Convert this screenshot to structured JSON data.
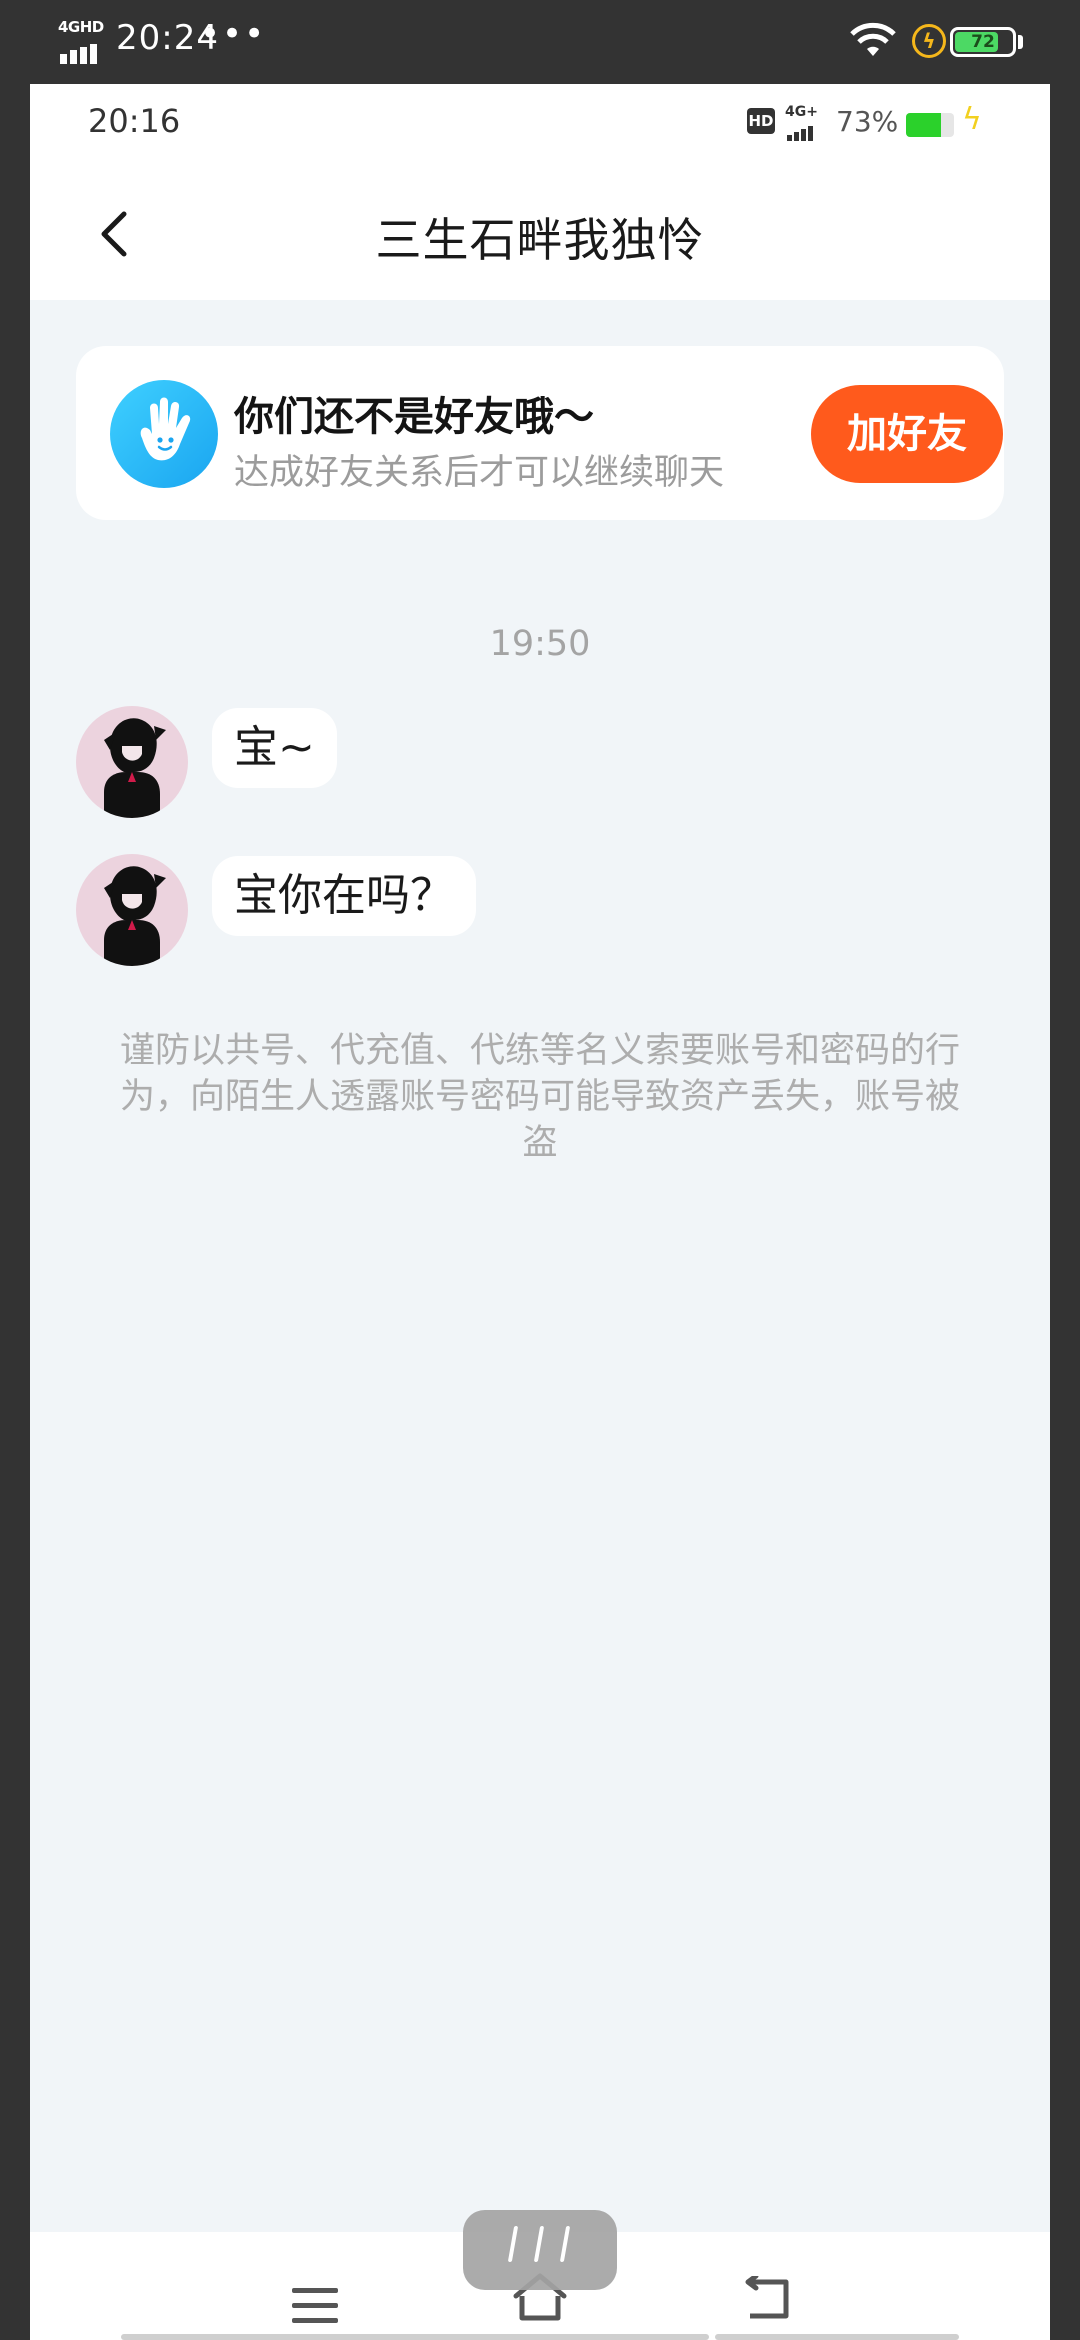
{
  "outer_status": {
    "network": "4GHD",
    "time": "20:24",
    "dots": "•••",
    "battery": "72",
    "battery_level": 0.72
  },
  "inner_status": {
    "time": "20:16",
    "hd": "HD",
    "network": "4G+",
    "battery_percent": "73%",
    "battery_level": 0.73
  },
  "header": {
    "title": "三生石畔我独怜",
    "back_icon": "chevron-left-icon"
  },
  "friend_banner": {
    "icon": "waving-hand-icon",
    "title": "你们还不是好友哦～",
    "subtitle": "达成好友关系后才可以继续聊天",
    "button_label": "加好友",
    "button_color": "#ff5a1c"
  },
  "chat": {
    "timestamp": "19:50",
    "messages": [
      {
        "text": "宝~"
      },
      {
        "text": "宝你在吗？"
      }
    ],
    "notice": "谨防以共号、代充值、代练等名义索要账号和密码的行为，向陌生人透露账号密码可能导致资产丢失，账号被盗"
  },
  "bottom_nav": {
    "icons": [
      "menu-icon",
      "home-icon",
      "return-icon"
    ]
  },
  "colors": {
    "background": "#f1f5f8",
    "accent": "#ff5a1c",
    "icon_blue": "#1aa5f0"
  }
}
